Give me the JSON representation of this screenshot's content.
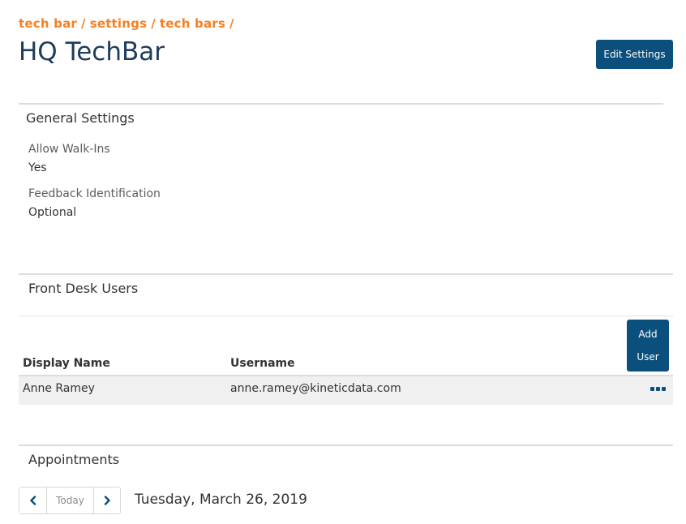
{
  "breadcrumb": {
    "items": [
      "tech bar",
      "settings",
      "tech bars"
    ],
    "separator": "/"
  },
  "page": {
    "title": "HQ TechBar"
  },
  "header": {
    "edit_settings_label": "Edit Settings"
  },
  "general_settings": {
    "title": "General Settings",
    "fields": [
      {
        "label": "Allow Walk-Ins",
        "value": "Yes"
      },
      {
        "label": "Feedback Identification",
        "value": "Optional"
      }
    ]
  },
  "front_desk_users": {
    "title": "Front Desk Users",
    "add_user_label": [
      "Add",
      "User"
    ],
    "columns": [
      "Display Name",
      "Username"
    ],
    "rows": [
      {
        "display_name": "Anne Ramey",
        "username": "anne.ramey@kineticdata.com",
        "actions_icon": "ellipsis-icon"
      }
    ]
  },
  "appointments": {
    "title": "Appointments",
    "prev_icon": "chevron-left-icon",
    "today_label": "Today",
    "next_icon": "chevron-right-icon",
    "current_date": "Tuesday, March 26, 2019"
  },
  "colors": {
    "breadcrumb": "#f58025",
    "title": "#1f3c5a",
    "primary_button": "#0b4f7c",
    "row_background": "#f0f0f0"
  }
}
